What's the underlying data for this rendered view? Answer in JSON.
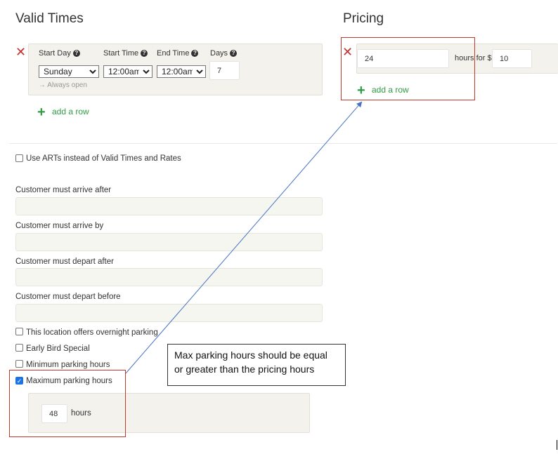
{
  "valid_times": {
    "title": "Valid Times",
    "row": {
      "start_day_label": "Start Day",
      "start_day_value": "Sunday",
      "start_time_label": "Start Time",
      "start_time_value": "12:00am",
      "end_time_label": "End Time",
      "end_time_value": "12:00am",
      "days_label": "Days",
      "days_value": "7",
      "note": "→ Always open"
    },
    "add_row_label": "add a row"
  },
  "pricing": {
    "title": "Pricing",
    "hours_value": "24",
    "hours_for_label": "hours for $",
    "price_value": "10",
    "add_row_label": "add a row"
  },
  "options": {
    "use_arts_label": "Use ARTs instead of Valid Times and Rates",
    "arrive_after_label": "Customer must arrive after",
    "arrive_by_label": "Customer must arrive by",
    "depart_after_label": "Customer must depart after",
    "depart_before_label": "Customer must depart before",
    "overnight_label": "This location offers overnight parking",
    "early_bird_label": "Early Bird Special",
    "min_hours_label": "Minimum parking hours",
    "max_hours_label": "Maximum parking hours",
    "max_hours_value": "48",
    "hours_unit": "hours"
  },
  "annotation": {
    "text": "Max parking hours should be equal or greater than the pricing hours",
    "box_color": "#c0392b",
    "arrow_color": "#4472c4"
  },
  "colors": {
    "accent_green": "#2e9d43",
    "remove_red": "#c9302c",
    "panel_bg": "#f3f2ec"
  }
}
